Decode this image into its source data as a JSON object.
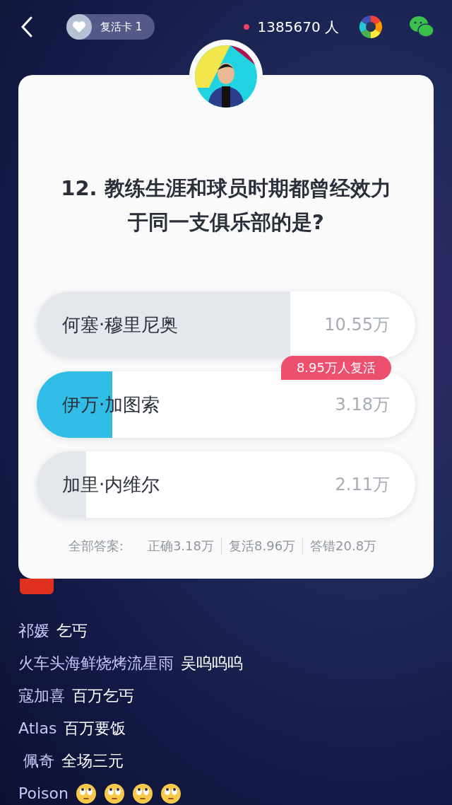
{
  "top_bar": {
    "revive_card": "复活卡 1",
    "viewers": "1385670 人"
  },
  "question": {
    "text": "12. 教练生涯和球员时期都曾经效力于同一支俱乐部的是?"
  },
  "options": [
    {
      "label": "何塞·穆里尼奥",
      "count": "10.55万",
      "level": 0.67,
      "selected": false
    },
    {
      "label": "伊万·加图索",
      "count": "3.18万",
      "level": 0.2,
      "selected": true,
      "badge": "8.95万人复活"
    },
    {
      "label": "加里·内维尔",
      "count": "2.11万",
      "level": 0.13,
      "selected": false
    }
  ],
  "summary": {
    "label": "全部答案:",
    "items": [
      "正确3.18万",
      "复活8.96万",
      "答错20.8万"
    ]
  },
  "chat": [
    {
      "user": "祁媛",
      "message": "乞丐"
    },
    {
      "user": "火车头海鲜烧烤流星雨",
      "message": "吴呜呜呜"
    },
    {
      "user": "寇加喜",
      "message": "百万乞丐"
    },
    {
      "user": "Atlas",
      "message": "百万要饭"
    },
    {
      "user": " 佩奇",
      "message": "全场三元"
    },
    {
      "user": "Poison",
      "emojis": [
        {
          "kind": "eye-roll"
        },
        {
          "kind": "eye-roll"
        },
        {
          "kind": "eye-roll"
        },
        {
          "kind": "eye-roll"
        }
      ]
    }
  ]
}
